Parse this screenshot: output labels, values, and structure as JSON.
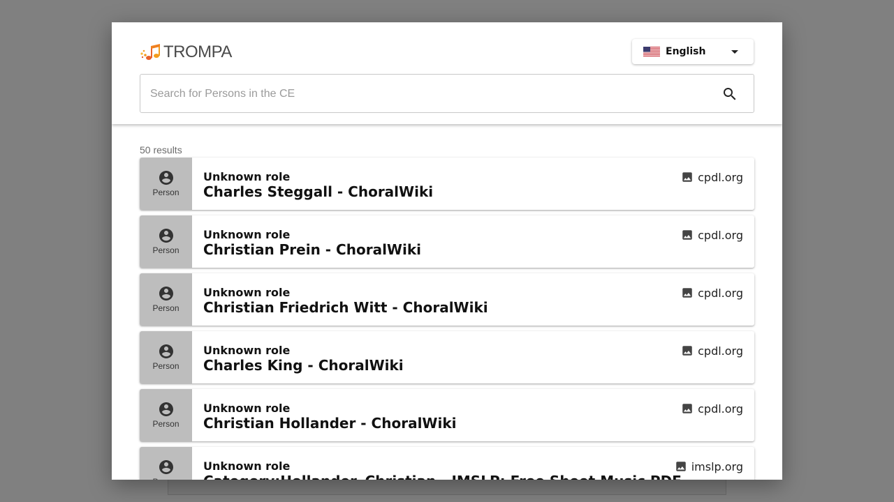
{
  "header": {
    "logo_text": "TROMPA",
    "language": {
      "selected": "English",
      "flag": "us-flag-icon"
    },
    "search": {
      "placeholder": "Search for Persons in the CE",
      "value": ""
    }
  },
  "results": {
    "count_label": "50 results",
    "items": [
      {
        "type": "Person",
        "role": "Unknown role",
        "title": "Charles Steggall - ChoralWiki",
        "source": "cpdl.org"
      },
      {
        "type": "Person",
        "role": "Unknown role",
        "title": "Christian Prein - ChoralWiki",
        "source": "cpdl.org"
      },
      {
        "type": "Person",
        "role": "Unknown role",
        "title": "Christian Friedrich Witt - ChoralWiki",
        "source": "cpdl.org"
      },
      {
        "type": "Person",
        "role": "Unknown role",
        "title": "Charles King - ChoralWiki",
        "source": "cpdl.org"
      },
      {
        "type": "Person",
        "role": "Unknown role",
        "title": "Christian Hollander - ChoralWiki",
        "source": "cpdl.org"
      },
      {
        "type": "Person",
        "role": "Unknown role",
        "title": "Category:Hollander, Christian - IMSLP: Free Sheet Music PDF",
        "source": "imslp.org"
      }
    ]
  },
  "colors": {
    "backdrop": "#808080",
    "type_block": "#bdbdbd",
    "logo_accent": "#f39c1e"
  }
}
